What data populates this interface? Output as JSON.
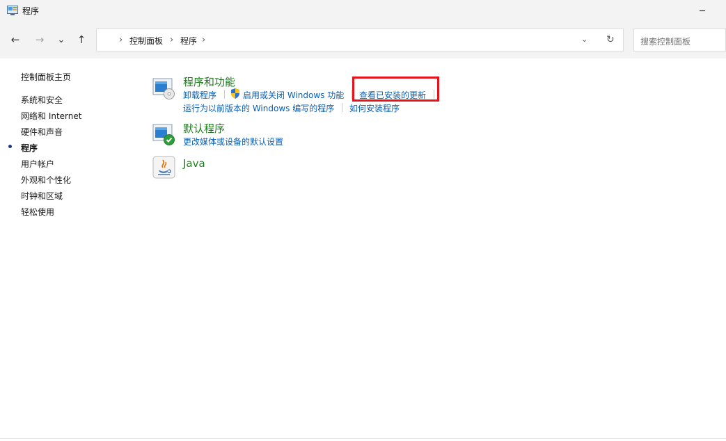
{
  "window": {
    "title": "程序",
    "minimize_glyph": "─"
  },
  "nav": {
    "back_glyph": "←",
    "forward_glyph": "→",
    "recent_glyph": "⌄",
    "up_glyph": "↑"
  },
  "address": {
    "crumbs": [
      "控制面板",
      "程序"
    ],
    "chevron": "›",
    "dropdown_glyph": "⌄",
    "refresh_glyph": "↻"
  },
  "search": {
    "placeholder": "搜索控制面板"
  },
  "sidebar": {
    "home": "控制面板主页",
    "items": [
      {
        "label": "系统和安全"
      },
      {
        "label": "网络和 Internet"
      },
      {
        "label": "硬件和声音"
      },
      {
        "label": "程序",
        "active": true
      },
      {
        "label": "用户帐户"
      },
      {
        "label": "外观和个性化"
      },
      {
        "label": "时钟和区域"
      },
      {
        "label": "轻松使用"
      }
    ]
  },
  "categories": [
    {
      "title": "程序和功能",
      "icon": "programs-features-icon",
      "links": [
        "卸载程序",
        "启用或关闭 Windows 功能",
        "查看已安装的更新",
        "运行为以前版本的 Windows 编写的程序",
        "如何安装程序"
      ]
    },
    {
      "title": "默认程序",
      "icon": "default-programs-icon",
      "links": [
        "更改媒体或设备的默认设置"
      ]
    },
    {
      "title": "Java",
      "icon": "java-icon",
      "links": []
    }
  ],
  "colors": {
    "link": "#0a5fb4",
    "category_title": "#1e7b1e",
    "highlight": "#e5141b"
  }
}
